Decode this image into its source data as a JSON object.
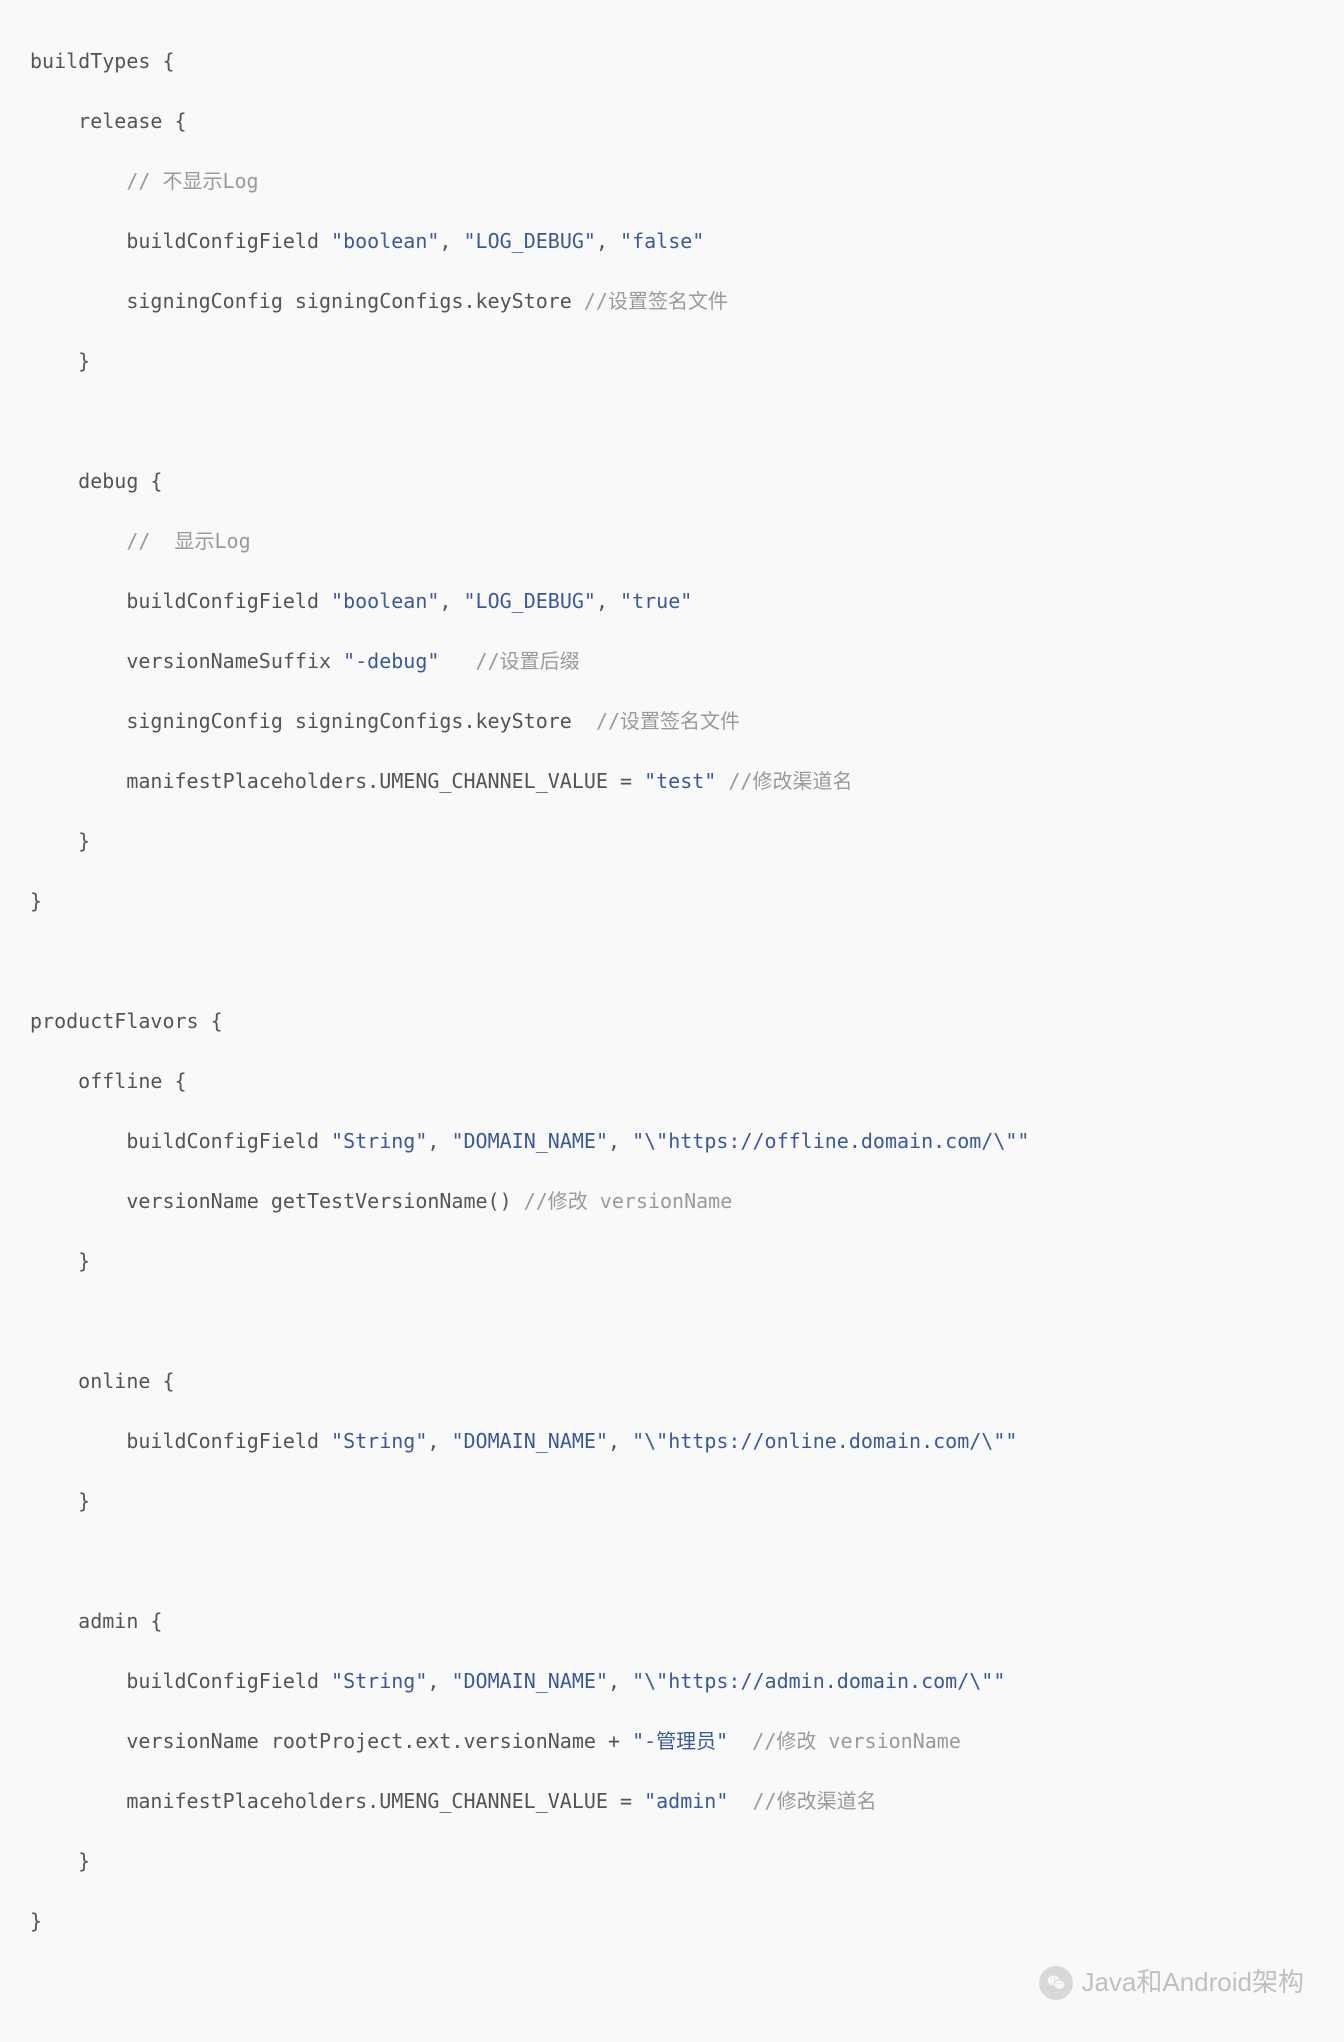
{
  "code": {
    "l01": "buildTypes {",
    "l02": "    release {",
    "l03a": "        ",
    "l03b": "// 不显示Log",
    "l04a": "        buildConfigField ",
    "l04b": "\"boolean\"",
    "l04c": ", ",
    "l04d": "\"LOG_DEBUG\"",
    "l04e": ", ",
    "l04f": "\"false\"",
    "l05a": "        signingConfig signingConfigs.keyStore ",
    "l05b": "//设置签名文件",
    "l06": "    }",
    "l07": "",
    "l08": "    debug {",
    "l09a": "        ",
    "l09b": "//  显示Log",
    "l10a": "        buildConfigField ",
    "l10b": "\"boolean\"",
    "l10c": ", ",
    "l10d": "\"LOG_DEBUG\"",
    "l10e": ", ",
    "l10f": "\"true\"",
    "l11a": "        versionNameSuffix ",
    "l11b": "\"-debug\"",
    "l11c": "   ",
    "l11d": "//设置后缀",
    "l12a": "        signingConfig signingConfigs.keyStore  ",
    "l12b": "//设置签名文件",
    "l13a": "        manifestPlaceholders.UMENG_CHANNEL_VALUE = ",
    "l13b": "\"test\"",
    "l13c": " ",
    "l13d": "//修改渠道名",
    "l14": "    }",
    "l15": "}",
    "l16": "",
    "l17": "productFlavors {",
    "l18": "    offline {",
    "l19a": "        buildConfigField ",
    "l19b": "\"String\"",
    "l19c": ", ",
    "l19d": "\"DOMAIN_NAME\"",
    "l19e": ", ",
    "l19f": "\"\\\"https://offline.domain.com/\\\"\"",
    "l20a": "        versionName getTestVersionName() ",
    "l20b": "//修改 versionName",
    "l21": "    }",
    "l22": "",
    "l23": "    online {",
    "l24a": "        buildConfigField ",
    "l24b": "\"String\"",
    "l24c": ", ",
    "l24d": "\"DOMAIN_NAME\"",
    "l24e": ", ",
    "l24f": "\"\\\"https://online.domain.com/\\\"\"",
    "l25": "    }",
    "l26": "",
    "l27": "    admin {",
    "l28a": "        buildConfigField ",
    "l28b": "\"String\"",
    "l28c": ", ",
    "l28d": "\"DOMAIN_NAME\"",
    "l28e": ", ",
    "l28f": "\"\\\"https://admin.domain.com/\\\"\"",
    "l29a": "        versionName rootProject.ext.versionName + ",
    "l29b": "\"-管理员\"",
    "l29c": "  ",
    "l29d": "//修改 versionName",
    "l30a": "        manifestPlaceholders.UMENG_CHANNEL_VALUE = ",
    "l30b": "\"admin\"",
    "l30c": "  ",
    "l30d": "//修改渠道名",
    "l31": "    }",
    "l32": "}"
  },
  "watermark": {
    "text": "Java和Android架构",
    "icon": "wechat"
  }
}
